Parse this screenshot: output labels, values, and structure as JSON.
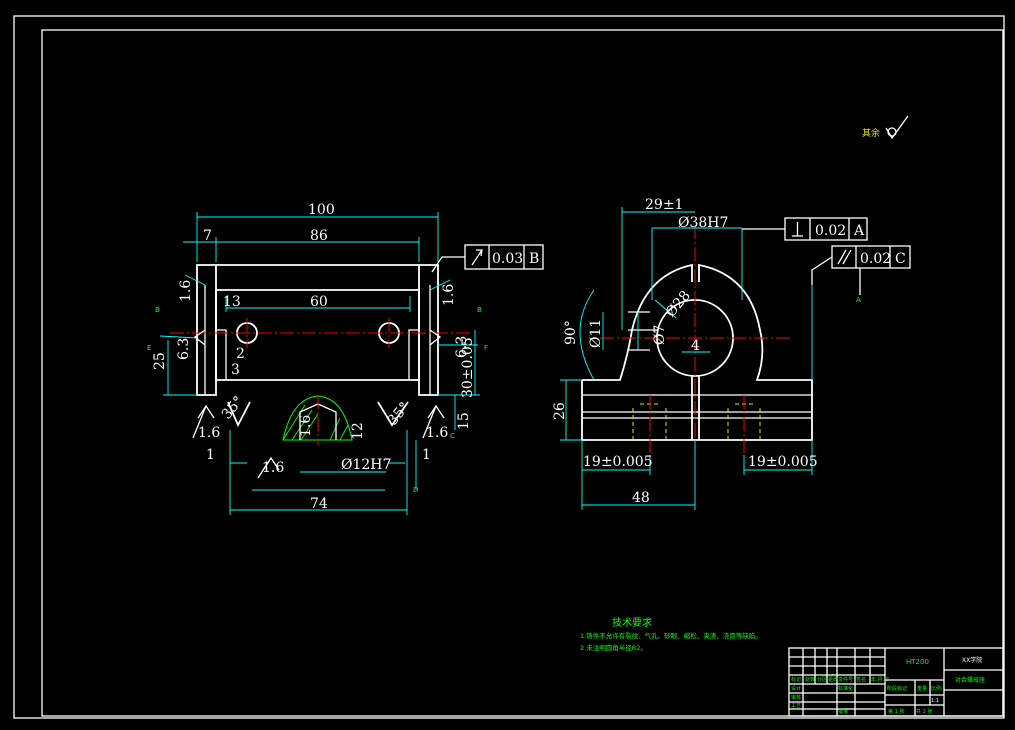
{
  "colors": {
    "outline": "#ffffff",
    "dimension": "#00ffff",
    "centerline": "#ff0000",
    "hidden": "#e8e800",
    "note": "#00ff00",
    "hatch": "#00ff00"
  },
  "front_view": {
    "dims": [
      "100",
      "7",
      "86",
      "1.6",
      "1.6",
      "13",
      "60",
      "6.3",
      "2",
      "3",
      "25",
      "6.3",
      "30±0.05",
      "15",
      "1.6",
      "35°",
      "1.6",
      "1.6",
      "12",
      "35°",
      "1.6",
      "1",
      "Ø12H7",
      "1",
      "74"
    ],
    "tolerance": {
      "symbol": "↗",
      "value": "0.03",
      "datum": "B"
    },
    "datum_markers": [
      "B",
      "E",
      "B",
      "F",
      "C",
      "D"
    ]
  },
  "side_view": {
    "dims": [
      "29±1",
      "Ø38H7",
      "Ø11",
      "Ø7",
      "Ø28",
      "90°",
      "4",
      "26",
      "19±0.005",
      "19±0.005",
      "48"
    ],
    "perpendicularity": {
      "symbol": "⊥",
      "value": "0.02",
      "datum": "A"
    },
    "parallelism": {
      "symbol": "//",
      "value": "0.02",
      "datum": "C"
    },
    "datum_marker": "A"
  },
  "surface_note": "其余",
  "tech_requirements": {
    "title": "技术要求",
    "items": [
      "1.铸件不允许有裂纹、气孔、砂眼、缩松、夹渣、浇冒等缺陷。",
      "2.未注明圆角半径R2。"
    ]
  },
  "title_block": {
    "material": "HT200",
    "school": "XX学院",
    "part_name": "对合螺母座",
    "scale": "1:1",
    "sheet": "第 1 张",
    "total": "共 2 张",
    "cells": [
      "标记",
      "处数",
      "分区",
      "更改文件号",
      "签名",
      "年.月.日",
      "设计",
      "标准化",
      "阶段标记",
      "重量",
      "比例",
      "审核",
      "工艺",
      "批准"
    ]
  }
}
